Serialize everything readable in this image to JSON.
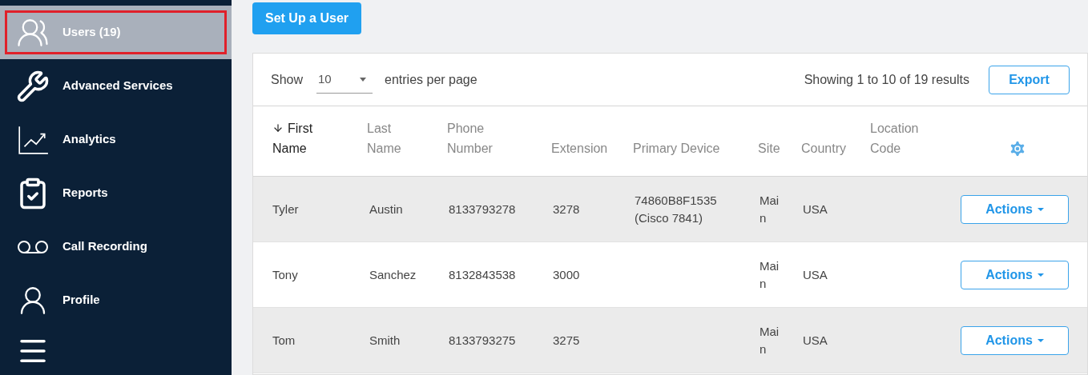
{
  "sidebar": {
    "items": [
      {
        "label": "Users (19)",
        "selected": true
      },
      {
        "label": "Advanced Services",
        "selected": false
      },
      {
        "label": "Analytics",
        "selected": false
      },
      {
        "label": "Reports",
        "selected": false
      },
      {
        "label": "Call Recording",
        "selected": false
      },
      {
        "label": "Profile",
        "selected": false
      }
    ]
  },
  "setup_button": "Set Up a User",
  "table": {
    "show_label": "Show",
    "page_size": "10",
    "per_page_label": "entries per page",
    "summary": "Showing 1 to 10 of 19 results",
    "export_button": "Export",
    "columns": [
      {
        "label": "First Name",
        "sorted": true
      },
      {
        "label": "Last Name",
        "sorted": false
      },
      {
        "label": "Phone Number",
        "sorted": false
      },
      {
        "label": "Extension",
        "sorted": false
      },
      {
        "label": "Primary Device",
        "sorted": false
      },
      {
        "label": "Site",
        "sorted": false
      },
      {
        "label": "Country",
        "sorted": false
      },
      {
        "label": "Location Code",
        "sorted": false
      }
    ],
    "rows": [
      {
        "cells": [
          "Tyler",
          "Austin",
          "8133793278",
          "3278",
          "74860B8F1535 (Cisco 7841)",
          "Main",
          "USA",
          ""
        ],
        "action": "Actions"
      },
      {
        "cells": [
          "Tony",
          "Sanchez",
          "8132843538",
          "3000",
          "",
          "Main",
          "USA",
          ""
        ],
        "action": "Actions"
      },
      {
        "cells": [
          "Tom",
          "Smith",
          "8133793275",
          "3275",
          "",
          "Main",
          "USA",
          ""
        ],
        "action": "Actions"
      }
    ]
  }
}
